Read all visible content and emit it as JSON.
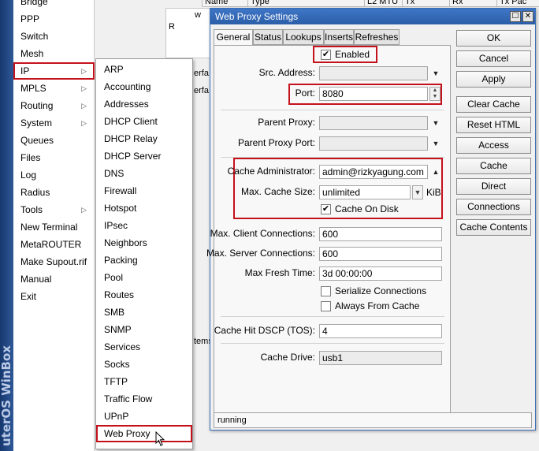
{
  "brand": {
    "text": "uterOS WinBox"
  },
  "side_menu": {
    "items": [
      {
        "label": "Bridge",
        "arrow": false
      },
      {
        "label": "PPP",
        "arrow": false
      },
      {
        "label": "Switch",
        "arrow": false
      },
      {
        "label": "Mesh",
        "arrow": false
      },
      {
        "label": "IP",
        "arrow": true
      },
      {
        "label": "MPLS",
        "arrow": true
      },
      {
        "label": "Routing",
        "arrow": true
      },
      {
        "label": "System",
        "arrow": true
      },
      {
        "label": "Queues",
        "arrow": false
      },
      {
        "label": "Files",
        "arrow": false
      },
      {
        "label": "Log",
        "arrow": false
      },
      {
        "label": "Radius",
        "arrow": false
      },
      {
        "label": "Tools",
        "arrow": true
      },
      {
        "label": "New Terminal",
        "arrow": false
      },
      {
        "label": "MetaROUTER",
        "arrow": false
      },
      {
        "label": "Make Supout.rif",
        "arrow": false
      },
      {
        "label": "Manual",
        "arrow": false
      },
      {
        "label": "Exit",
        "arrow": false
      }
    ],
    "active": "IP"
  },
  "ip_submenu": {
    "items": [
      "ARP",
      "Accounting",
      "Addresses",
      "DHCP Client",
      "DHCP Relay",
      "DHCP Server",
      "DNS",
      "Firewall",
      "Hotspot",
      "IPsec",
      "Neighbors",
      "Packing",
      "Pool",
      "Routes",
      "SMB",
      "SNMP",
      "Services",
      "Socks",
      "TFTP",
      "Traffic Flow",
      "UPnP",
      "Web Proxy"
    ],
    "active": "Web Proxy"
  },
  "background_window": {
    "columns": [
      "Name",
      "Type",
      "L2 MTU",
      "Tx",
      "Rx",
      "Tx Pac"
    ],
    "row_flag": "R",
    "row_text": "w",
    "panel_text_1": "erfa",
    "panel_text_2": "erfa",
    "panel_text_3": "tems"
  },
  "dialog": {
    "title": "Web Proxy Settings",
    "tabs": [
      "General",
      "Status",
      "Lookups",
      "Inserts",
      "Refreshes"
    ],
    "active_tab": "General",
    "enabled": {
      "label": "Enabled",
      "checked": true
    },
    "src_address": {
      "label": "Src. Address:",
      "value": ""
    },
    "port": {
      "label": "Port:",
      "value": "8080"
    },
    "parent_proxy": {
      "label": "Parent Proxy:",
      "value": ""
    },
    "parent_proxy_port": {
      "label": "Parent Proxy Port:",
      "value": ""
    },
    "cache_admin": {
      "label": "Cache Administrator:",
      "value": "admin@rizkyagung.com"
    },
    "max_cache_size": {
      "label": "Max. Cache Size:",
      "value": "unlimited",
      "unit": "KiB"
    },
    "cache_on_disk": {
      "label": "Cache On Disk",
      "checked": true
    },
    "max_client_conn": {
      "label": "Max. Client Connections:",
      "value": "600"
    },
    "max_server_conn": {
      "label": "Max. Server Connections:",
      "value": "600"
    },
    "max_fresh_time": {
      "label": "Max Fresh Time:",
      "value": "3d 00:00:00"
    },
    "serialize_conn": {
      "label": "Serialize Connections",
      "checked": false
    },
    "always_from_cache": {
      "label": "Always From Cache",
      "checked": false
    },
    "cache_hit_dscp": {
      "label": "Cache Hit DSCP (TOS):",
      "value": "4"
    },
    "cache_drive": {
      "label": "Cache Drive:",
      "value": "usb1"
    },
    "buttons": [
      "OK",
      "Cancel",
      "Apply",
      "Clear Cache",
      "Reset HTML",
      "Access",
      "Cache",
      "Direct",
      "Connections",
      "Cache Contents"
    ],
    "status": "running",
    "titlebar_buttons": {
      "maximize": "☐",
      "close": "✕"
    }
  },
  "colors": {
    "highlight": "#c4121c",
    "titlebar": "#2c5ea8",
    "brand_strip": "#1e4583"
  }
}
